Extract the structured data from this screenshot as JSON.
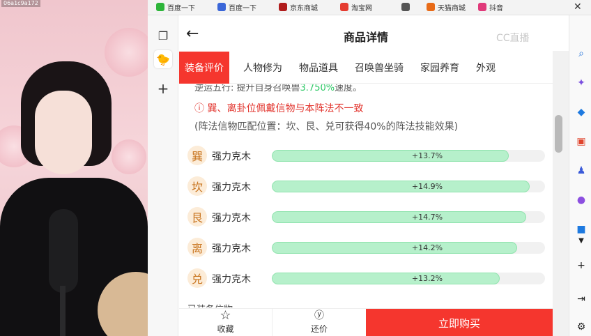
{
  "camera": {
    "overlay_label": "06a1c9a172"
  },
  "bookmarks": [
    {
      "label": "百度一下",
      "color": "#2db53a"
    },
    {
      "label": "百度一下",
      "color": "#3a66d8"
    },
    {
      "label": "京东商城",
      "color": "#b01c1c"
    },
    {
      "label": "淘宝网",
      "color": "#e53b2f"
    },
    {
      "label": "",
      "color": "#555555"
    },
    {
      "label": "天猫商城",
      "color": "#e86b18"
    },
    {
      "label": "抖音",
      "color": "#e03a7a"
    }
  ],
  "page": {
    "title": "商品详情",
    "watermark": "CC直播",
    "tabs": [
      {
        "label": "装备评价",
        "active": true
      },
      {
        "label": "人物修为",
        "active": false
      },
      {
        "label": "物品道具",
        "active": false
      },
      {
        "label": "召唤兽坐骑",
        "active": false
      },
      {
        "label": "家园养育",
        "active": false
      },
      {
        "label": "外观",
        "active": false
      }
    ],
    "cut_line": {
      "text": "逆运五行: 提升自身召唤兽",
      "pct": "3.750%",
      "tail": "速度。"
    },
    "warning": "巽、离卦位佩戴信物与本阵法不一致",
    "note": "(阵法信物匹配位置：坎、艮、兑可获得40%的阵法技能效果)",
    "rows": [
      {
        "badge": "巽",
        "label": "强力克木",
        "value": "+13.7%",
        "fill": 0.137
      },
      {
        "badge": "坎",
        "label": "强力克木",
        "value": "+14.9%",
        "fill": 0.149
      },
      {
        "badge": "艮",
        "label": "强力克木",
        "value": "+14.7%",
        "fill": 0.147
      },
      {
        "badge": "离",
        "label": "强力克木",
        "value": "+14.2%",
        "fill": 0.142
      },
      {
        "badge": "兑",
        "label": "强力克木",
        "value": "+13.2%",
        "fill": 0.132
      }
    ],
    "section_cut": "已装备信物",
    "bottom": {
      "collect_label": "收藏",
      "bargain_label": "还价",
      "buy_label": "立即购买"
    }
  }
}
